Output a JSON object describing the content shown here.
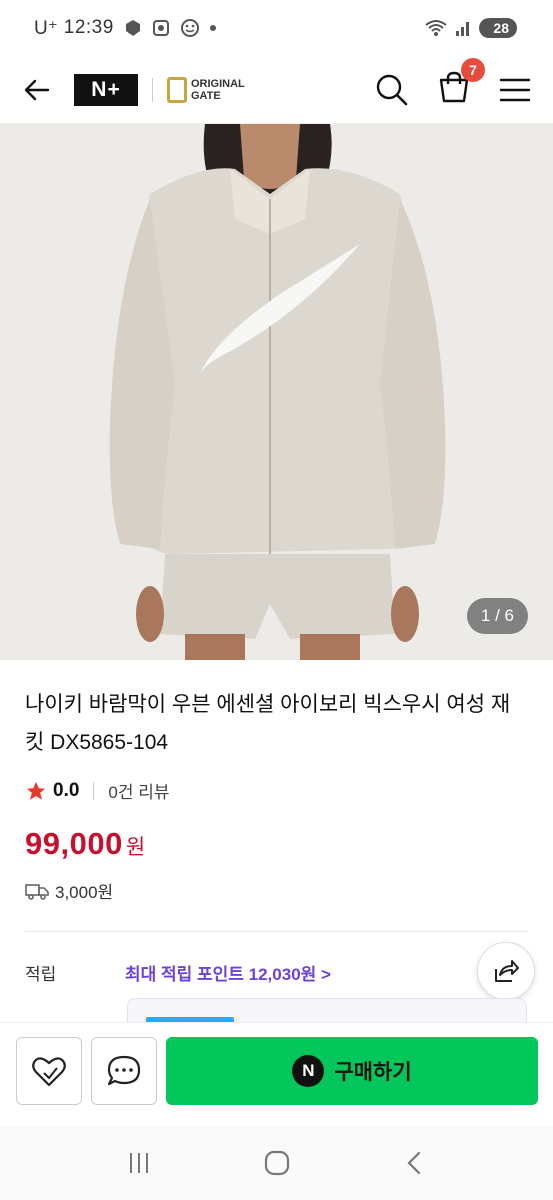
{
  "status_bar": {
    "carrier": "U⁺",
    "time": "12:39",
    "battery": "28"
  },
  "header": {
    "logo_text": "N+",
    "brand_line1": "ORIGINAL",
    "brand_line2": "GATE",
    "cart_count": "7"
  },
  "gallery": {
    "counter": "1 / 6"
  },
  "product": {
    "title": "나이키 바람막이 우븐 에센셜 아이보리 빅스우시 여성 재킷 DX5865-104",
    "rating": "0.0",
    "reviews": "0건 리뷰",
    "price": "99,000",
    "currency": "원",
    "shipping": "3,000원"
  },
  "points": {
    "label": "적립",
    "value": "최대 적립 포인트 12,030원 >"
  },
  "actions": {
    "buy_label": "구매하기",
    "buy_logo": "N"
  },
  "colors": {
    "accent_green": "#03c75a",
    "price_red": "#c8102e",
    "points_purple": "#6b44d6",
    "badge_red": "#e84a3b"
  }
}
